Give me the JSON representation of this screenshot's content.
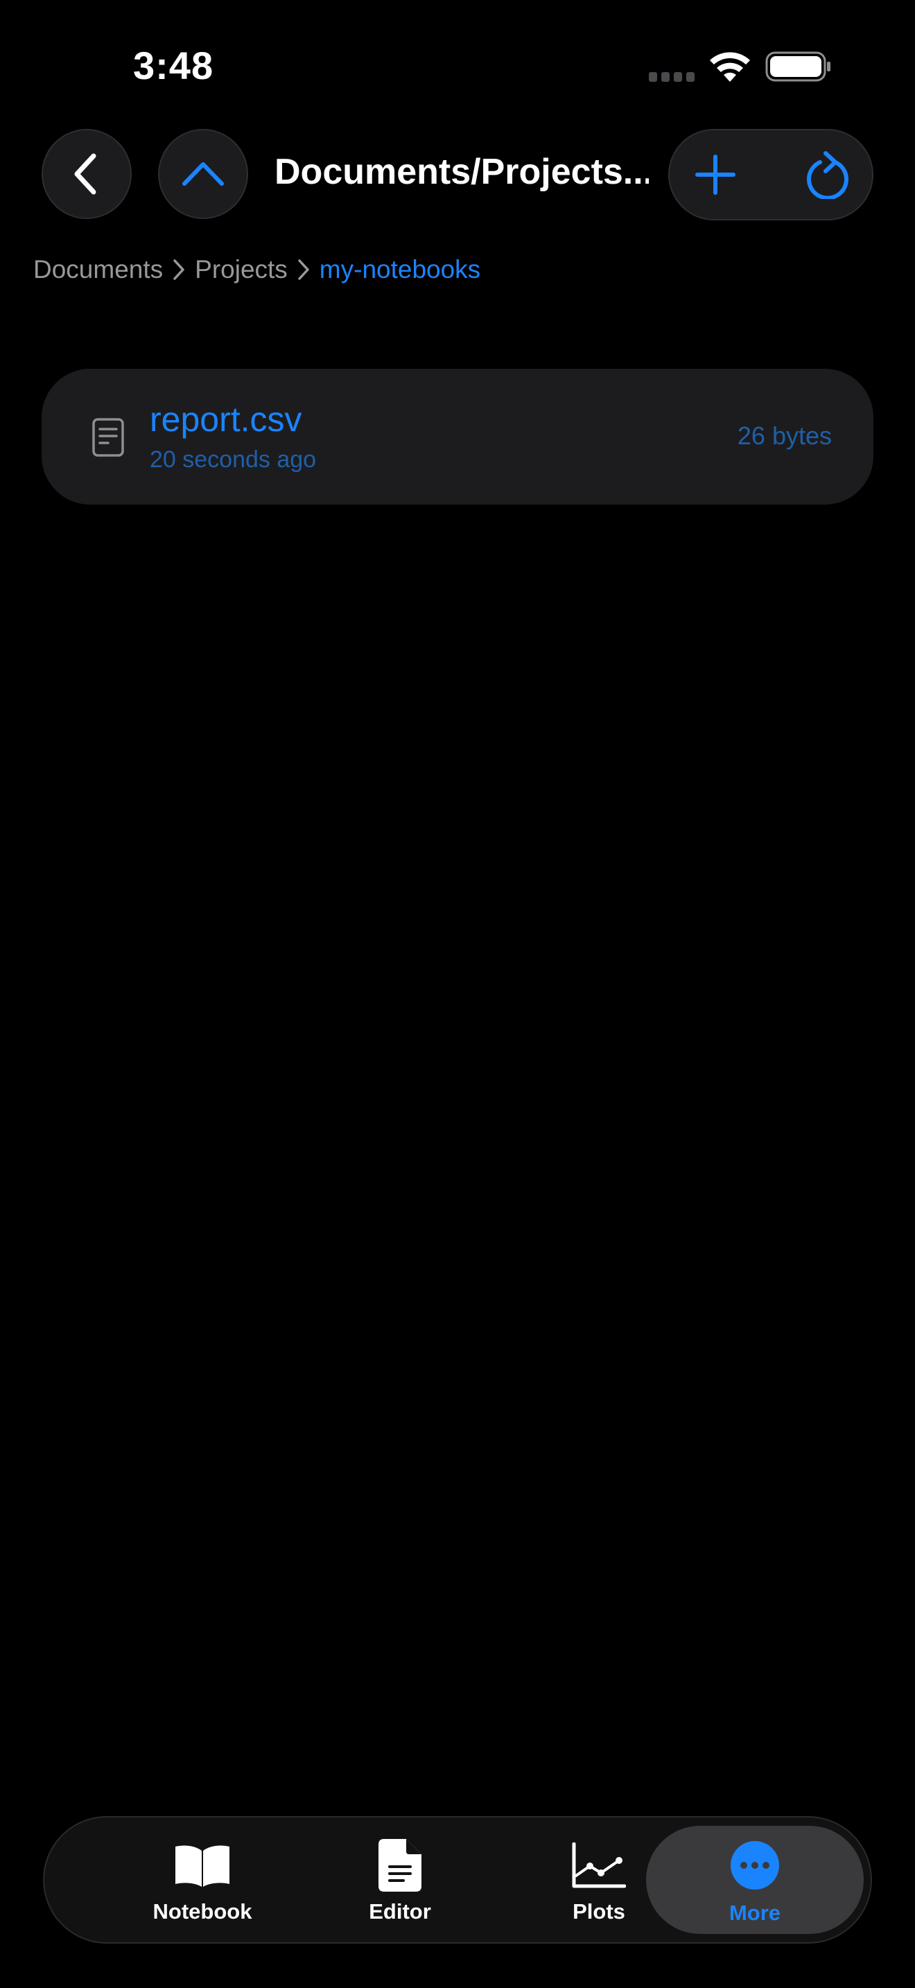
{
  "status_bar": {
    "time": "3:48",
    "signal_icon": "cellular-signal-icon",
    "wifi_icon": "wifi-icon",
    "battery_icon": "battery-icon"
  },
  "nav": {
    "back_icon": "chevron-left-icon",
    "up_icon": "chevron-up-icon",
    "title": "Documents/Projects...",
    "add_icon": "plus-icon",
    "refresh_icon": "refresh-icon"
  },
  "breadcrumb": [
    {
      "label": "Documents",
      "current": false
    },
    {
      "label": "Projects",
      "current": false
    },
    {
      "label": "my-notebooks",
      "current": true
    }
  ],
  "files": [
    {
      "name": "report.csv",
      "modified": "20 seconds ago",
      "size": "26 bytes",
      "icon": "document-icon"
    }
  ],
  "tab_bar": {
    "tabs": [
      {
        "label": "Notebook",
        "icon": "book-icon",
        "selected": false
      },
      {
        "label": "Editor",
        "icon": "doc-text-icon",
        "selected": false
      },
      {
        "label": "Plots",
        "icon": "line-chart-icon",
        "selected": false
      },
      {
        "label": "More",
        "icon": "ellipsis-circle-icon",
        "selected": true
      }
    ]
  },
  "colors": {
    "accent": "#1a84ff",
    "background": "#000000",
    "surface": "#1c1c1e",
    "secondary_text": "#98989d"
  }
}
